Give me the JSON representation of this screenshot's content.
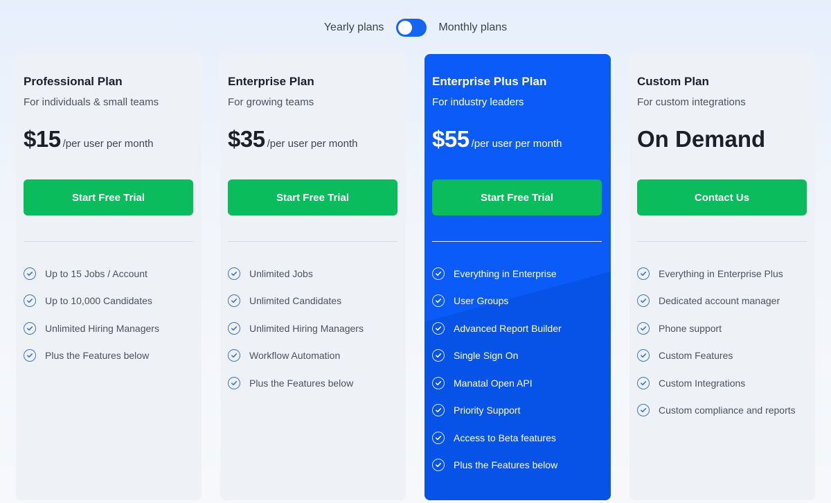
{
  "billing_toggle": {
    "left_label": "Yearly plans",
    "right_label": "Monthly plans",
    "selected": "Monthly plans"
  },
  "colors": {
    "accent": "#1565f5",
    "highlight_card": "#0a5bf7",
    "cta_green": "#0abc5c",
    "check_blue": "#3b73d6"
  },
  "plans": [
    {
      "title": "Professional Plan",
      "subtitle": "For individuals & small teams",
      "price": "$15",
      "price_unit": "/per user per month",
      "cta": "Start Free Trial",
      "features": [
        "Up to 15 Jobs / Account",
        "Up to 10,000 Candidates",
        "Unlimited Hiring Managers",
        "Plus the Features below"
      ]
    },
    {
      "title": "Enterprise Plan",
      "subtitle": "For growing teams",
      "price": "$35",
      "price_unit": "/per user per month",
      "cta": "Start Free Trial",
      "features": [
        "Unlimited Jobs",
        "Unlimited Candidates",
        "Unlimited Hiring Managers",
        "Workflow Automation",
        "Plus the Features below"
      ]
    },
    {
      "title": "Enterprise Plus Plan",
      "subtitle": "For industry leaders",
      "price": "$55",
      "price_unit": "/per user per month",
      "cta": "Start Free Trial",
      "highlighted": true,
      "features": [
        "Everything in Enterprise",
        "User Groups",
        "Advanced Report Builder",
        "Single Sign On",
        "Manatal Open API",
        "Priority Support",
        "Access to Beta features",
        "Plus the Features below"
      ]
    },
    {
      "title": "Custom Plan",
      "subtitle": "For custom integrations",
      "price": "On Demand",
      "price_unit": "",
      "cta": "Contact Us",
      "features": [
        "Everything in Enterprise Plus",
        "Dedicated account manager",
        "Phone support",
        "Custom Features",
        "Custom Integrations",
        "Custom compliance and reports"
      ]
    }
  ]
}
